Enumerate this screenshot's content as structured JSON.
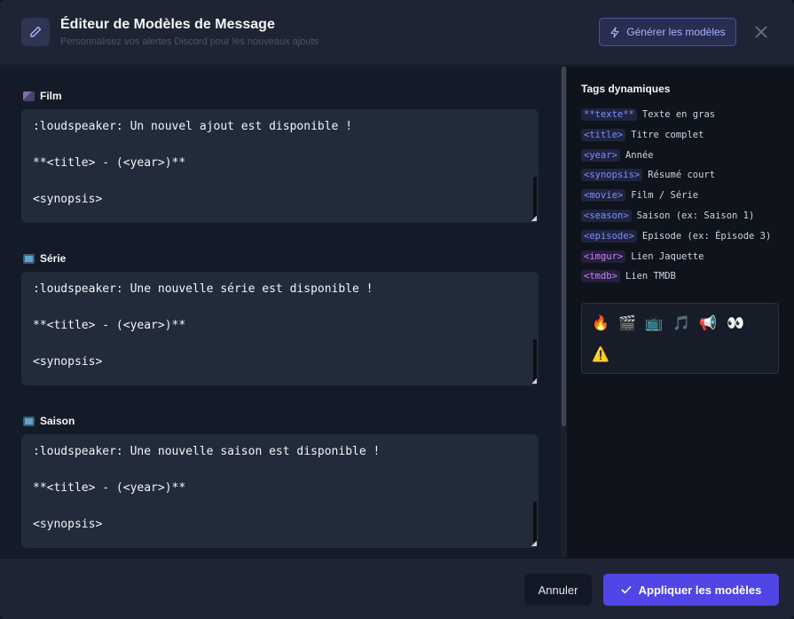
{
  "header": {
    "title": "Éditeur de Modèles de Message",
    "subtitle": "Personnalisez vos alertes Discord pour les nouveaux ajouts",
    "generate_label": "Générer les modèles"
  },
  "sections": [
    {
      "label": "Film",
      "lines": [
        ":loudspeaker: Un nouvel ajout est disponible !",
        "",
        "**<title> - (<year>)**",
        "",
        "<synopsis>"
      ]
    },
    {
      "label": "Série",
      "lines": [
        ":loudspeaker: Une nouvelle série est disponible !",
        "",
        "**<title> - (<year>)**",
        "",
        "<synopsis>"
      ]
    },
    {
      "label": "Saison",
      "lines": [
        ":loudspeaker: Une nouvelle saison est disponible !",
        "",
        "**<title> - (<year>)**",
        "",
        "<synopsis>"
      ]
    }
  ],
  "sidebar": {
    "title": "Tags dynamiques",
    "tags": [
      {
        "tag": "**texte**",
        "desc": "Texte en gras"
      },
      {
        "tag": "<title>",
        "desc": "Titre complet"
      },
      {
        "tag": "<year>",
        "desc": "Année"
      },
      {
        "tag": "<synopsis>",
        "desc": "Résumé court"
      },
      {
        "tag": "<movie>",
        "desc": "Film / Série"
      },
      {
        "tag": "<season>",
        "desc": "Saison (ex: Saison 1)"
      },
      {
        "tag": "<episode>",
        "desc": "Episode (ex: Épisode 3)"
      },
      {
        "tag": "<imgur>",
        "desc": "Lien Jaquette"
      },
      {
        "tag": "<tmdb>",
        "desc": "Lien TMDB"
      }
    ],
    "emojis": [
      "🔥",
      "🎬",
      "📺",
      "🎵",
      "📢",
      "👀",
      "⚠️"
    ]
  },
  "footer": {
    "cancel_label": "Annuler",
    "apply_label": "Appliquer les modèles"
  },
  "colors": {
    "accent": "#4f46e5",
    "tag": "#818cf8",
    "tag_purple": "#c084fc"
  }
}
